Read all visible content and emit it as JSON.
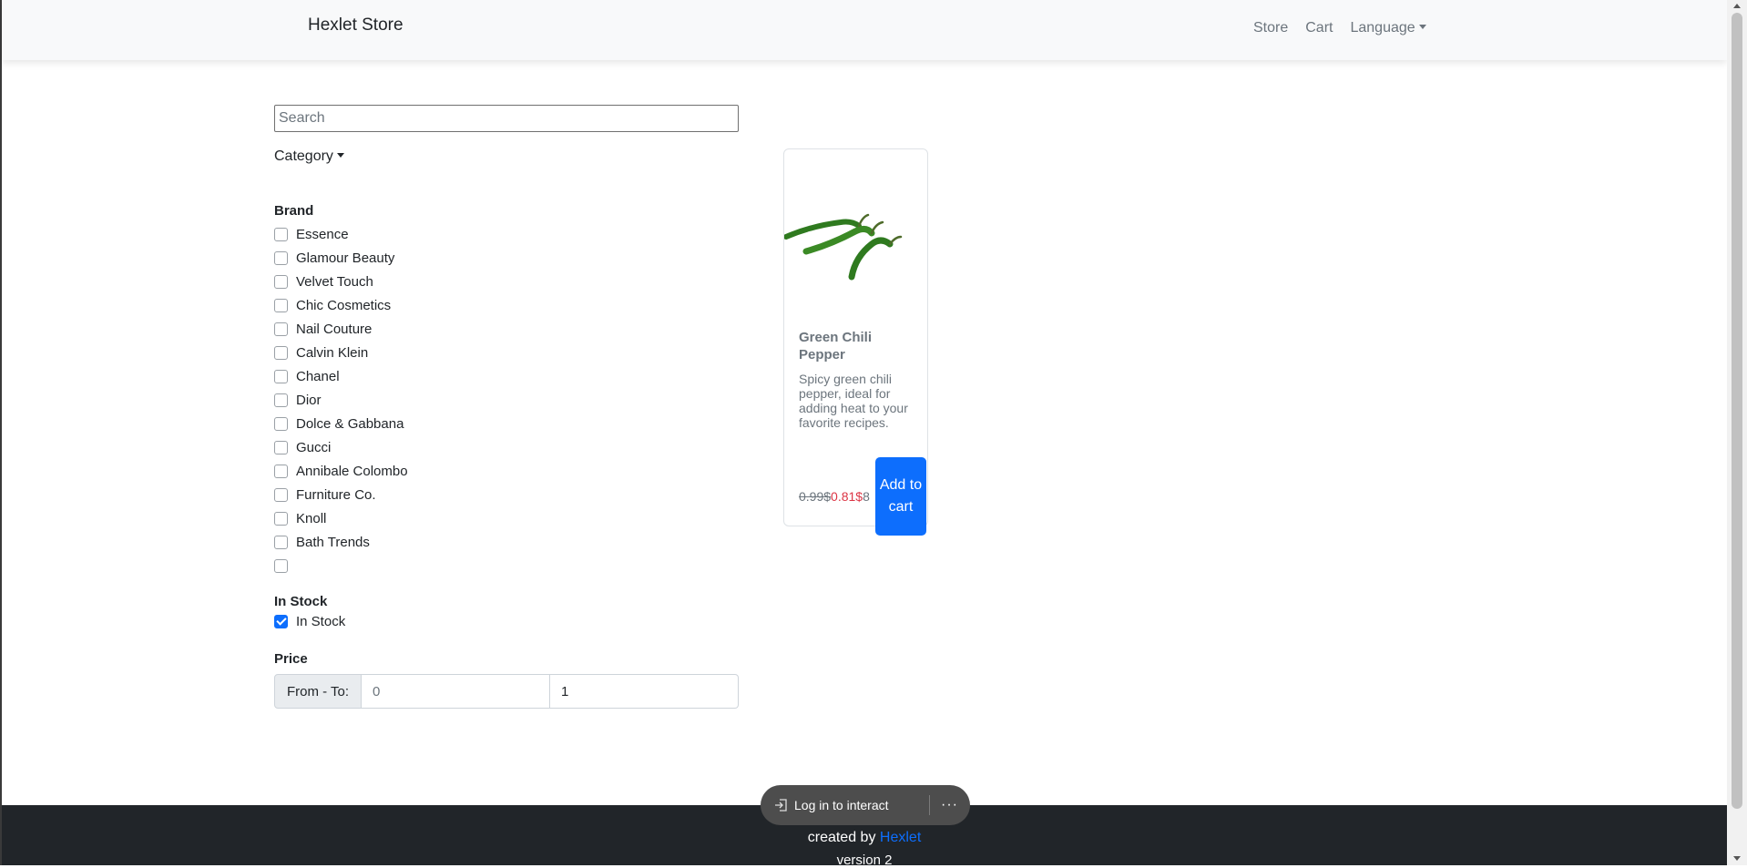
{
  "navbar": {
    "brand": "Hexlet Store",
    "links": {
      "store": "Store",
      "cart": "Cart",
      "language": "Language"
    }
  },
  "filters": {
    "search": {
      "placeholder": "Search",
      "value": ""
    },
    "category_label": "Category",
    "brand_title": "Brand",
    "brands": [
      {
        "label": "Essence",
        "checked": false
      },
      {
        "label": "Glamour Beauty",
        "checked": false
      },
      {
        "label": "Velvet Touch",
        "checked": false
      },
      {
        "label": "Chic Cosmetics",
        "checked": false
      },
      {
        "label": "Nail Couture",
        "checked": false
      },
      {
        "label": "Calvin Klein",
        "checked": false
      },
      {
        "label": "Chanel",
        "checked": false
      },
      {
        "label": "Dior",
        "checked": false
      },
      {
        "label": "Dolce & Gabbana",
        "checked": false
      },
      {
        "label": "Gucci",
        "checked": false
      },
      {
        "label": "Annibale Colombo",
        "checked": false
      },
      {
        "label": "Furniture Co.",
        "checked": false
      },
      {
        "label": "Knoll",
        "checked": false
      },
      {
        "label": "Bath Trends",
        "checked": false
      },
      {
        "label": "",
        "checked": false
      }
    ],
    "stock_title": "In Stock",
    "stock_option": {
      "label": "In Stock",
      "checked": true
    },
    "price_title": "Price",
    "price_label": "From - To:",
    "price_from": "0",
    "price_to": "1"
  },
  "product": {
    "image_icon": "green-chili-pepper-image",
    "title": "Green Chili Pepper",
    "description": "Spicy green chili pepper, ideal for adding heat to your favorite recipes.",
    "old_price": "0.99$",
    "new_price": "0.81$",
    "price_tail": "8",
    "add_to_cart": "Add to cart"
  },
  "footer": {
    "created_by": "created by",
    "link": "Hexlet",
    "version": "version 2"
  },
  "overlay": {
    "login": "Log in to interact",
    "more_icon": "more-dots-icon"
  },
  "colors": {
    "accent": "#0d6efd",
    "sale": "#dc3545",
    "footer_bg": "#212529",
    "navbar_bg": "#f8f9fa"
  }
}
